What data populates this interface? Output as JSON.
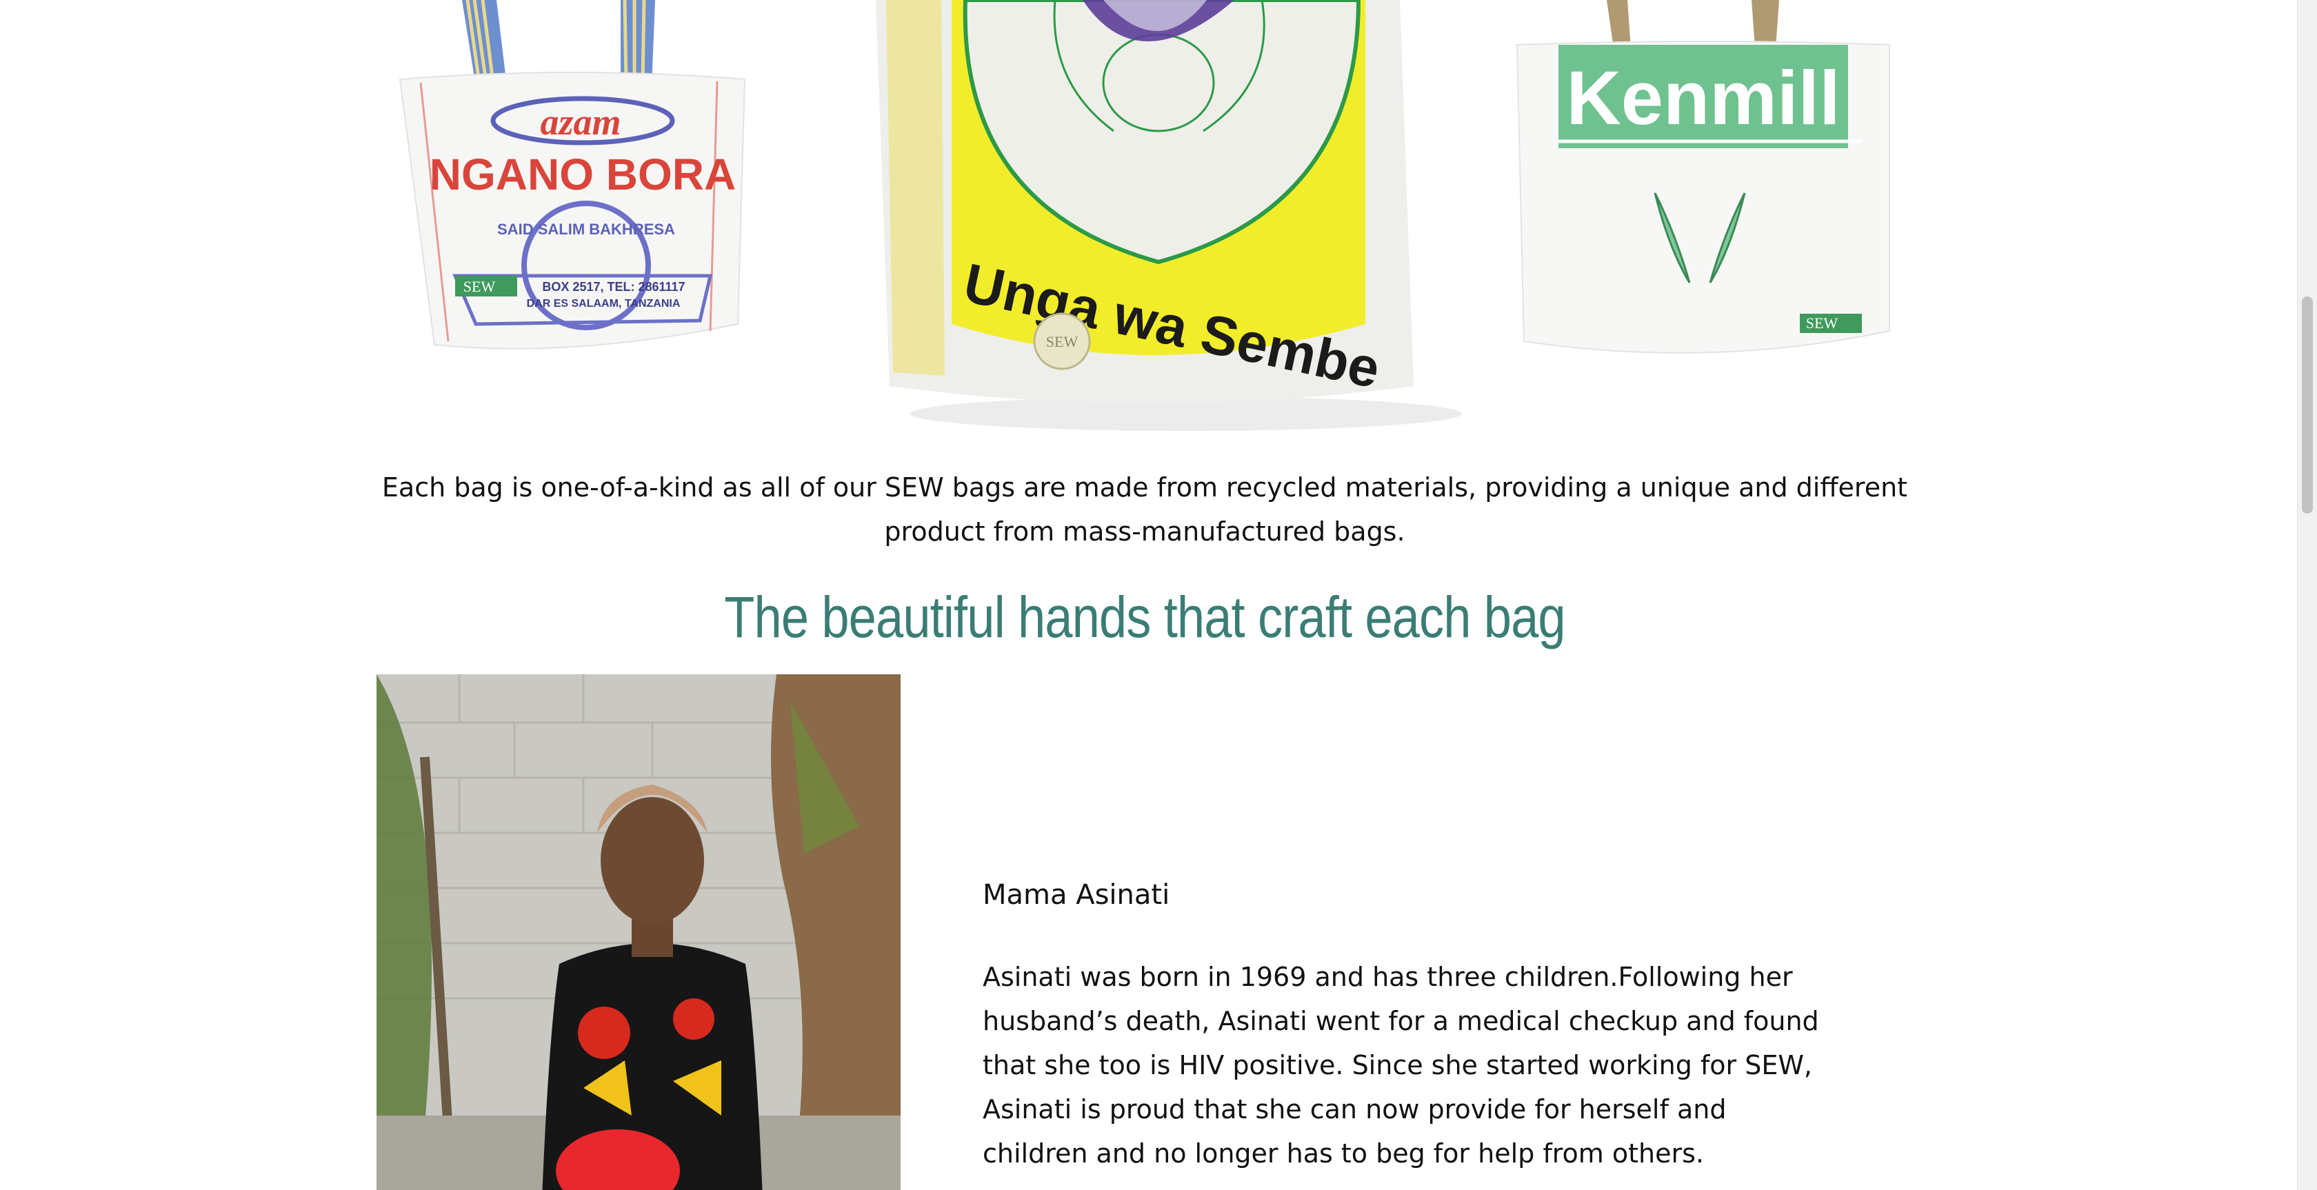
{
  "bags": [
    {
      "brand_top": "azam",
      "brand_main": "NGANO BORA",
      "seal_text": "SAID SALIM BAKHRESA",
      "address_line1": "BOX 2517, TEL: 2861117",
      "address_line2": "DAR ES SALAAM, TANZANIA",
      "tag": "SEW"
    },
    {
      "brand_main": "Unga wa Sembe",
      "tag": "SEW"
    },
    {
      "brand_main": "Kenmill",
      "tag": "SEW"
    }
  ],
  "caption": "Each bag is one-of-a-kind as all of our SEW bags are made from recycled materials, providing a unique and different product from mass-manufactured bags.",
  "heading": "The beautiful hands that craft each bag",
  "artisan": {
    "name": "Mama Asinati",
    "bio": "Asinati was born in 1969 and has three children.Following her husband’s death, Asinati went for a medical checkup and found that she too is HIV positive. Since she started working for SEW, Asinati is proud that she can now provide for herself and children and no longer has to beg for help from others."
  },
  "colors": {
    "accent": "#3a7d74",
    "text": "#111111"
  }
}
